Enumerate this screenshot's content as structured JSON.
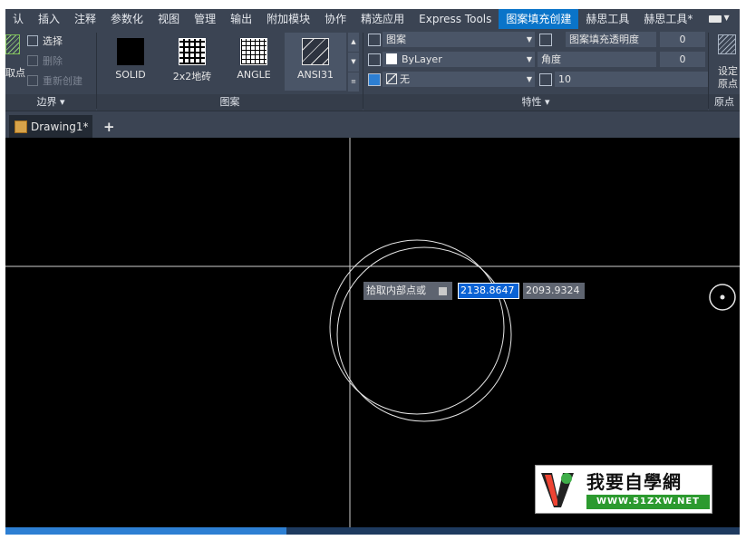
{
  "menubar": {
    "tabs": [
      {
        "label": "认"
      },
      {
        "label": "插入"
      },
      {
        "label": "注释"
      },
      {
        "label": "参数化"
      },
      {
        "label": "视图"
      },
      {
        "label": "管理"
      },
      {
        "label": "输出"
      },
      {
        "label": "附加模块"
      },
      {
        "label": "协作"
      },
      {
        "label": "精选应用"
      },
      {
        "label": "Express Tools"
      },
      {
        "label": "图案填充创建"
      },
      {
        "label": "赫思工具"
      },
      {
        "label": "赫思工具*"
      }
    ],
    "active_tab": "图案填充创建"
  },
  "ribbon": {
    "boundary": {
      "pick_label": "取点",
      "select_label": "选择",
      "delete_label": "删除",
      "recreate_label": "重新创建",
      "panel_title": "边界 ▾"
    },
    "pattern": {
      "items": [
        {
          "label": "SOLID"
        },
        {
          "label": "2x2地砖"
        },
        {
          "label": "ANGLE"
        },
        {
          "label": "ANSI31"
        }
      ],
      "selected": "ANSI31",
      "panel_title": "图案"
    },
    "properties": {
      "type_value": "图案",
      "color_value": "ByLayer",
      "bg_value": "无",
      "transparency_label": "图案填充透明度",
      "transparency_value": "0",
      "angle_label": "角度",
      "angle_value": "0",
      "scale_value": "10",
      "panel_title": "特性 ▾"
    },
    "origin": {
      "set_label": "设定",
      "origin_label": "原点",
      "panel_title": "原点"
    }
  },
  "tabs": {
    "document": "Drawing1*",
    "add": "+"
  },
  "canvas": {
    "prompt_text": "拾取内部点或",
    "x_input": "2138.8647",
    "y_input": "2093.9324"
  },
  "watermark": {
    "main_text": "我要自學網",
    "url_text": "WWW.51ZXW.NET"
  },
  "colors": {
    "ribbon_bg": "#3b4453",
    "active_tab": "#0a74c9",
    "canvas_bg": "#000000",
    "input_highlight": "#0a62d4"
  }
}
